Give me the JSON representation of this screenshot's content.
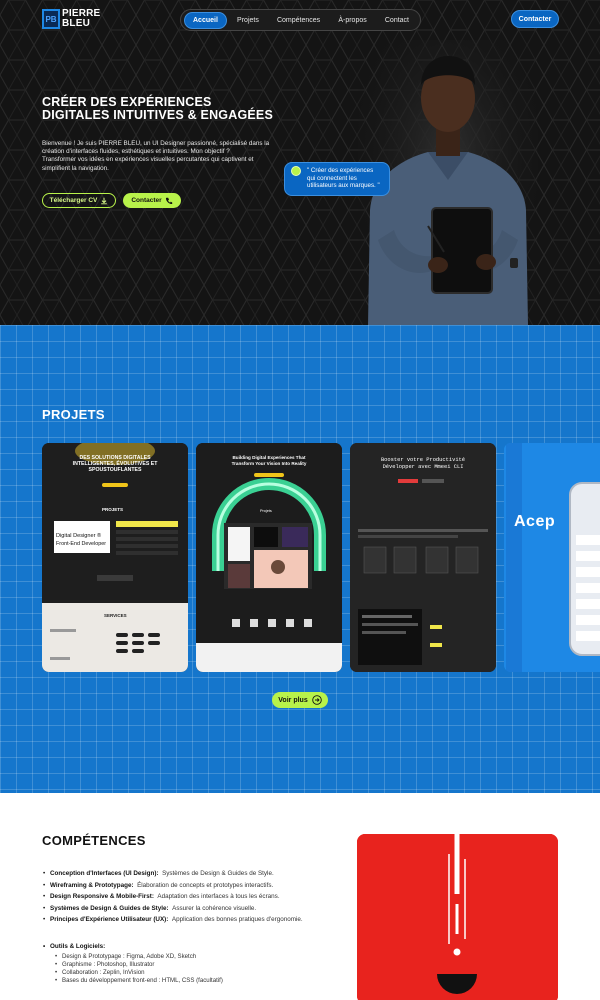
{
  "brand": {
    "logo_mark": "PB",
    "name_line1": "PIERRE",
    "name_line2": "BLEU"
  },
  "nav": {
    "items": [
      {
        "label": "Accueil",
        "active": true
      },
      {
        "label": "Projets",
        "active": false
      },
      {
        "label": "Compétences",
        "active": false
      },
      {
        "label": "À-propos",
        "active": false
      },
      {
        "label": "Contact",
        "active": false
      }
    ],
    "contact_button": "Contacter"
  },
  "hero": {
    "title": "CRÉER DES EXPÉRIENCES DIGITALES INTUITIVES & ENGAGÉES",
    "desc_p1": "Bienvenue ! Je suis PIERRE BLEU, un UI Designer passionné, spécialisé dans la création d'interfaces fluides, esthétiques et intuitives. Mon objectif ?",
    "desc_p2": "Transformer vos idées en expériences visuelles percutantes qui captivent et simplifient la navigation.",
    "cv_button": "Télécharger CV",
    "contact_button": "Contacter",
    "quote": "\" Créer des expériences qui connectent les utilisateurs aux marques. \""
  },
  "projects": {
    "title": "PROJETS",
    "card1": {
      "headline": "DES SOLUTIONS DIGITALES INTELLIGENTES, ÉVOLUTIVES ET SPOUSTOUFLANTES",
      "section": "PROJETS",
      "big_text_1": "Digital Designer ®",
      "big_text_2": "Front-End Developer",
      "services": "SERVICES"
    },
    "card2": {
      "headline": "Building Digital Experiences That Transform Your Vision Into Reality",
      "section": "Projets"
    },
    "card3": {
      "headline_1": "Booster votre Productivité",
      "headline_2": "Développer avec Mmeei CLI"
    },
    "card4": {
      "brand": "Acep"
    },
    "more_button": "Voir plus"
  },
  "skills": {
    "title": "COMPÉTENCES",
    "items": [
      {
        "name": "Conception d'Interfaces (UI Design):",
        "desc": "Systèmes de Design & Guides de Style."
      },
      {
        "name": "Wireframing & Prototypage:",
        "desc": "Élaboration de concepts et prototypes interactifs."
      },
      {
        "name": "Design Responsive & Mobile-First:",
        "desc": "Adaptation des interfaces à tous les écrans."
      },
      {
        "name": "Systèmes de Design & Guides de Style:",
        "desc": "Assurer la cohérence visuelle."
      },
      {
        "name": "Principes d'Expérience Utilisateur (UX):",
        "desc": "Application des bonnes pratiques d'ergonomie."
      }
    ],
    "tools_heading": "Outils & Logiciels:",
    "tools": [
      "Design & Prototypage : Figma, Adobe XD, Sketch",
      "Graphisme : Photoshop, Illustrator",
      "Collaboration : Zeplin, InVision",
      "Bases du développement front-end : HTML, CSS (facultatif)"
    ]
  },
  "colors": {
    "primary_blue": "#0a66c2",
    "accent_lime": "#b8f24a",
    "hero_bg": "#141414",
    "projects_bg": "#1576cc",
    "red_card": "#e8231e"
  },
  "icons": [
    "download-icon",
    "phone-icon",
    "arrow-right-icon"
  ]
}
